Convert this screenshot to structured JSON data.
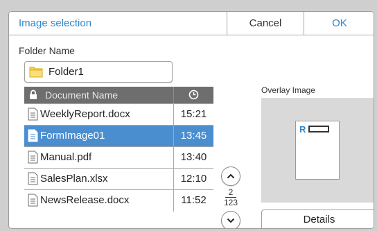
{
  "dialog": {
    "title": "Image selection",
    "cancel_label": "Cancel",
    "ok_label": "OK"
  },
  "folder": {
    "label": "Folder Name",
    "value": "Folder1",
    "icon": "folder-icon"
  },
  "list": {
    "header": {
      "name_label": "Document Name",
      "lock_icon": "lock-icon",
      "time_icon": "clock-icon"
    },
    "rows": [
      {
        "name": "WeeklyReport.docx",
        "time": "15:21",
        "selected": false
      },
      {
        "name": "FormImage01",
        "time": "13:45",
        "selected": true
      },
      {
        "name": "Manual.pdf",
        "time": "13:40",
        "selected": false
      },
      {
        "name": "SalesPlan.xlsx",
        "time": "12:10",
        "selected": false
      },
      {
        "name": "NewsRelease.docx",
        "time": "11:52",
        "selected": false
      }
    ]
  },
  "pager": {
    "current": "2",
    "total": "123",
    "up_icon": "chevron-up-icon",
    "down_icon": "chevron-down-icon"
  },
  "overlay": {
    "label": "Overlay Image",
    "preview_letter": "R"
  },
  "details_label": "Details",
  "colors": {
    "accent": "#2e86c8",
    "selected_row": "#4a8ed0",
    "header_bg": "#6e6e6e",
    "preview_bg": "#d9d9d9"
  }
}
